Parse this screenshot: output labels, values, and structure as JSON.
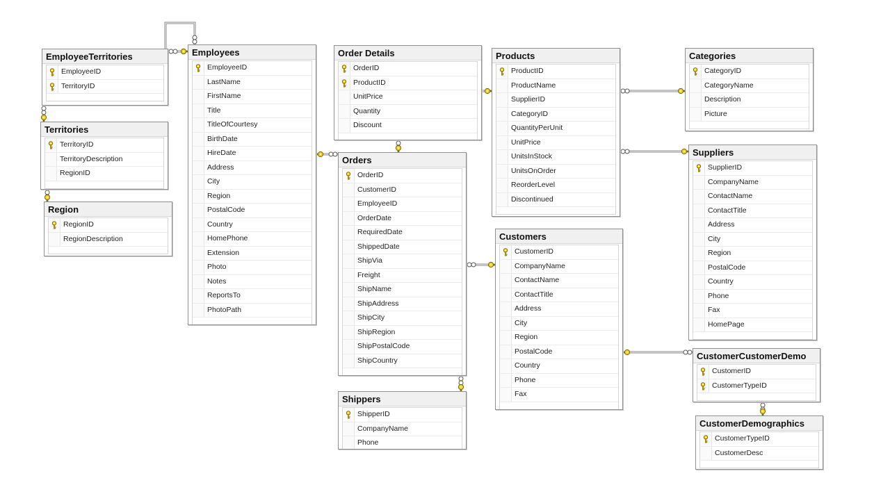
{
  "tables": [
    {
      "id": "EmployeeTerritories",
      "name": "EmployeeTerritories",
      "columns": [
        {
          "name": "EmployeeID",
          "pk": true
        },
        {
          "name": "TerritoryID",
          "pk": true
        }
      ]
    },
    {
      "id": "Employees",
      "name": "Employees",
      "columns": [
        {
          "name": "EmployeeID",
          "pk": true
        },
        {
          "name": "LastName"
        },
        {
          "name": "FirstName"
        },
        {
          "name": "Title"
        },
        {
          "name": "TitleOfCourtesy"
        },
        {
          "name": "BirthDate"
        },
        {
          "name": "HireDate"
        },
        {
          "name": "Address"
        },
        {
          "name": "City"
        },
        {
          "name": "Region"
        },
        {
          "name": "PostalCode"
        },
        {
          "name": "Country"
        },
        {
          "name": "HomePhone"
        },
        {
          "name": "Extension"
        },
        {
          "name": "Photo"
        },
        {
          "name": "Notes"
        },
        {
          "name": "ReportsTo"
        },
        {
          "name": "PhotoPath"
        }
      ]
    },
    {
      "id": "Territories",
      "name": "Territories",
      "columns": [
        {
          "name": "TerritoryID",
          "pk": true
        },
        {
          "name": "TerritoryDescription"
        },
        {
          "name": "RegionID"
        }
      ]
    },
    {
      "id": "Region",
      "name": "Region",
      "columns": [
        {
          "name": "RegionID",
          "pk": true
        },
        {
          "name": "RegionDescription"
        }
      ]
    },
    {
      "id": "OrderDetails",
      "name": "Order Details",
      "columns": [
        {
          "name": "OrderID",
          "pk": true
        },
        {
          "name": "ProductID",
          "pk": true
        },
        {
          "name": "UnitPrice"
        },
        {
          "name": "Quantity"
        },
        {
          "name": "Discount"
        }
      ]
    },
    {
      "id": "Orders",
      "name": "Orders",
      "columns": [
        {
          "name": "OrderID",
          "pk": true
        },
        {
          "name": "CustomerID"
        },
        {
          "name": "EmployeeID"
        },
        {
          "name": "OrderDate"
        },
        {
          "name": "RequiredDate"
        },
        {
          "name": "ShippedDate"
        },
        {
          "name": "ShipVia"
        },
        {
          "name": "Freight"
        },
        {
          "name": "ShipName"
        },
        {
          "name": "ShipAddress"
        },
        {
          "name": "ShipCity"
        },
        {
          "name": "ShipRegion"
        },
        {
          "name": "ShipPostalCode"
        },
        {
          "name": "ShipCountry"
        }
      ]
    },
    {
      "id": "Shippers",
      "name": "Shippers",
      "columns": [
        {
          "name": "ShipperID",
          "pk": true
        },
        {
          "name": "CompanyName"
        },
        {
          "name": "Phone"
        }
      ]
    },
    {
      "id": "Products",
      "name": "Products",
      "columns": [
        {
          "name": "ProductID",
          "pk": true
        },
        {
          "name": "ProductName"
        },
        {
          "name": "SupplierID"
        },
        {
          "name": "CategoryID"
        },
        {
          "name": "QuantityPerUnit"
        },
        {
          "name": "UnitPrice"
        },
        {
          "name": "UnitsInStock"
        },
        {
          "name": "UnitsOnOrder"
        },
        {
          "name": "ReorderLevel"
        },
        {
          "name": "Discontinued"
        }
      ]
    },
    {
      "id": "Customers",
      "name": "Customers",
      "columns": [
        {
          "name": "CustomerID",
          "pk": true
        },
        {
          "name": "CompanyName"
        },
        {
          "name": "ContactName"
        },
        {
          "name": "ContactTitle"
        },
        {
          "name": "Address"
        },
        {
          "name": "City"
        },
        {
          "name": "Region"
        },
        {
          "name": "PostalCode"
        },
        {
          "name": "Country"
        },
        {
          "name": "Phone"
        },
        {
          "name": "Fax"
        }
      ]
    },
    {
      "id": "Categories",
      "name": "Categories",
      "columns": [
        {
          "name": "CategoryID",
          "pk": true
        },
        {
          "name": "CategoryName"
        },
        {
          "name": "Description"
        },
        {
          "name": "Picture"
        }
      ]
    },
    {
      "id": "Suppliers",
      "name": "Suppliers",
      "columns": [
        {
          "name": "SupplierID",
          "pk": true
        },
        {
          "name": "CompanyName"
        },
        {
          "name": "ContactName"
        },
        {
          "name": "ContactTitle"
        },
        {
          "name": "Address"
        },
        {
          "name": "City"
        },
        {
          "name": "Region"
        },
        {
          "name": "PostalCode"
        },
        {
          "name": "Country"
        },
        {
          "name": "Phone"
        },
        {
          "name": "Fax"
        },
        {
          "name": "HomePage"
        }
      ]
    },
    {
      "id": "CustomerCustomerDemo",
      "name": "CustomerCustomerDemo",
      "columns": [
        {
          "name": "CustomerID",
          "pk": true
        },
        {
          "name": "CustomerTypeID",
          "pk": true
        }
      ]
    },
    {
      "id": "CustomerDemographics",
      "name": "CustomerDemographics",
      "columns": [
        {
          "name": "CustomerTypeID",
          "pk": true
        },
        {
          "name": "CustomerDesc"
        }
      ]
    }
  ],
  "relationships": [
    {
      "from": "Employees",
      "to": "Employees"
    },
    {
      "from": "EmployeeTerritories",
      "to": "Employees"
    },
    {
      "from": "EmployeeTerritories",
      "to": "Territories"
    },
    {
      "from": "Territories",
      "to": "Region"
    },
    {
      "from": "Orders",
      "to": "Employees"
    },
    {
      "from": "OrderDetails",
      "to": "Orders"
    },
    {
      "from": "OrderDetails",
      "to": "Products"
    },
    {
      "from": "Products",
      "to": "Categories"
    },
    {
      "from": "Products",
      "to": "Suppliers"
    },
    {
      "from": "Orders",
      "to": "Customers"
    },
    {
      "from": "Orders",
      "to": "Shippers"
    },
    {
      "from": "CustomerCustomerDemo",
      "to": "Customers"
    },
    {
      "from": "CustomerCustomerDemo",
      "to": "CustomerDemographics"
    }
  ],
  "colors": {
    "key_icon": "#f2d21b",
    "connector_line": "#8a8a8a",
    "title_bar": "#f0f0f0"
  }
}
